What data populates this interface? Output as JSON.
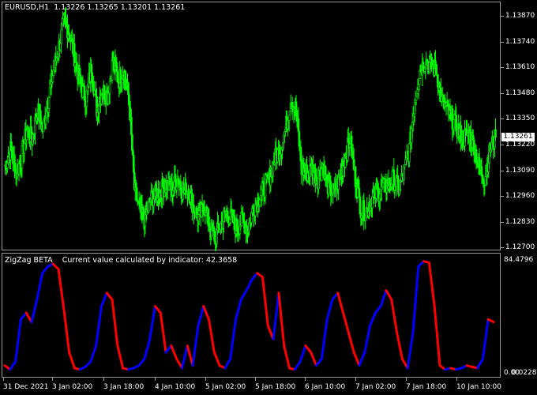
{
  "window": {
    "symbol_caption": "EURUSD,H1  1.13226 1.13265 1.13201 1.13261",
    "current_price": "1.13261"
  },
  "price_axis": {
    "ticks": [
      "1.13870",
      "1.13740",
      "1.13610",
      "1.13480",
      "1.13350",
      "1.13220",
      "1.13090",
      "1.12960",
      "1.12830",
      "1.12700"
    ]
  },
  "indicator": {
    "caption": "ZigZag BETA    Current value calculated by indicator: 42.3658",
    "max_label": "84.4796",
    "min_label": "0.00",
    "min_label_overlap": "0.0228"
  },
  "time_axis": {
    "labels": [
      "31 Dec 2021",
      "3 Jan 02:00",
      "3 Jan 18:00",
      "4 Jan 10:00",
      "5 Jan 02:00",
      "5 Jan 18:00",
      "6 Jan 10:00",
      "7 Jan 02:00",
      "7 Jan 18:00",
      "10 Jan 10:00"
    ]
  },
  "colors": {
    "background": "#000000",
    "candle": "#00ff00",
    "zigzag_up": "#0000ff",
    "zigzag_down": "#ff0000",
    "grid_border": "#9a9a9a"
  },
  "chart_data": [
    {
      "type": "line",
      "title": "EURUSD,H1",
      "ylim": [
        1.127,
        1.139
      ],
      "y_ticks": [
        1.1387,
        1.1374,
        1.1361,
        1.1348,
        1.1335,
        1.1322,
        1.1309,
        1.1296,
        1.1283,
        1.127
      ],
      "series": [
        {
          "name": "EURUSD,H1",
          "values": [
            1.1312,
            1.132,
            1.1308,
            1.1315,
            1.133,
            1.1325,
            1.134,
            1.133,
            1.1345,
            1.136,
            1.1372,
            1.1385,
            1.1378,
            1.1365,
            1.1352,
            1.1345,
            1.1362,
            1.134,
            1.135,
            1.1347,
            1.1365,
            1.1355,
            1.136,
            1.1345,
            1.13,
            1.1288,
            1.1285,
            1.1295,
            1.1297,
            1.13,
            1.1302,
            1.13,
            1.1305,
            1.1298,
            1.13,
            1.129,
            1.1285,
            1.1292,
            1.128,
            1.1275,
            1.1282,
            1.1288,
            1.1285,
            1.128,
            1.1284,
            1.128,
            1.129,
            1.1295,
            1.13,
            1.1305,
            1.1315,
            1.132,
            1.133,
            1.1345,
            1.134,
            1.131,
            1.1308,
            1.131,
            1.1305,
            1.1312,
            1.13,
            1.1298,
            1.1305,
            1.1315,
            1.1325,
            1.1305,
            1.129,
            1.1288,
            1.1295,
            1.1298,
            1.13,
            1.1302,
            1.1305,
            1.13,
            1.1308,
            1.132,
            1.1345,
            1.136,
            1.1365,
            1.1362,
            1.136,
            1.1345,
            1.134,
            1.1335,
            1.133,
            1.1325,
            1.1328,
            1.1322,
            1.131,
            1.1305,
            1.132,
            1.1326
          ]
        }
      ]
    },
    {
      "type": "line",
      "title": "ZigZag BETA",
      "ylim": [
        0.0228,
        84.4796
      ],
      "current_value": 42.3658,
      "series": [
        {
          "name": "ZigZag BETA",
          "values": [
            5,
            2,
            8,
            40,
            45,
            38,
            55,
            75,
            80,
            82,
            78,
            48,
            15,
            3,
            2,
            4,
            8,
            20,
            50,
            60,
            55,
            20,
            3,
            2,
            3,
            5,
            10,
            25,
            50,
            45,
            15,
            20,
            10,
            3,
            20,
            5,
            35,
            50,
            40,
            15,
            5,
            3,
            10,
            40,
            55,
            62,
            70,
            75,
            72,
            35,
            25,
            60,
            20,
            3,
            2,
            8,
            20,
            15,
            5,
            10,
            40,
            55,
            60,
            45,
            30,
            15,
            5,
            15,
            35,
            45,
            50,
            62,
            55,
            30,
            10,
            3,
            30,
            80,
            84,
            83,
            50,
            5,
            2,
            3,
            2,
            3,
            5,
            4,
            3,
            10,
            40,
            38
          ]
        }
      ]
    }
  ]
}
